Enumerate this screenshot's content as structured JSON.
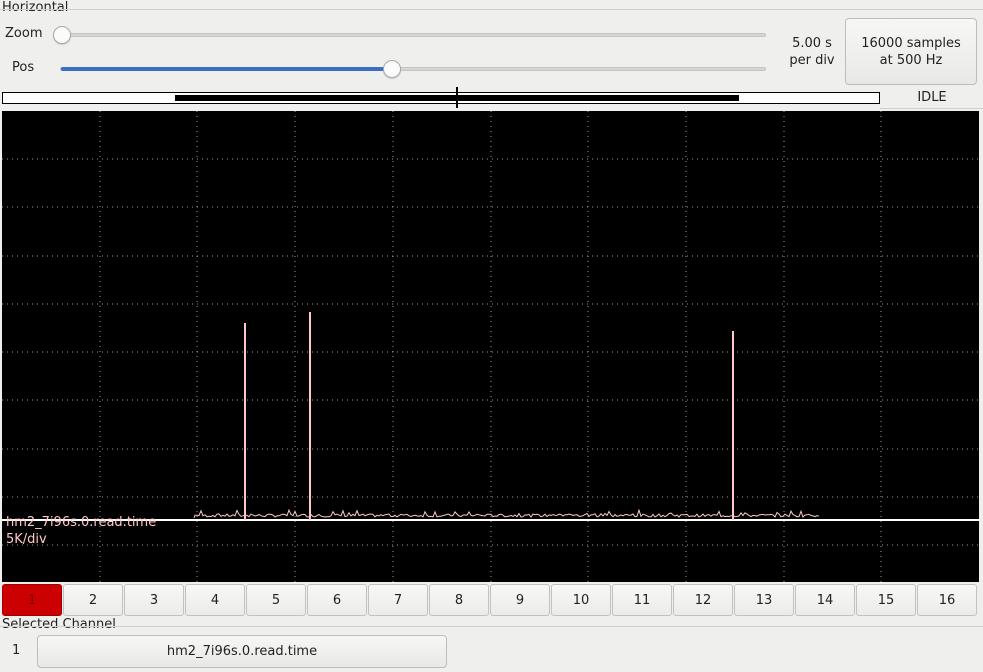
{
  "horizontal": {
    "section_label": "Horizontal",
    "zoom_label": "Zoom",
    "pos_label": "Pos",
    "zoom_fraction": 0.0,
    "pos_fraction": 0.47,
    "timebase_text": "5.00 s\nper div",
    "samples_button": "16000 samples\nat 500 Hz"
  },
  "status": {
    "state": "IDLE"
  },
  "scope": {
    "background": "#000000",
    "grid_color": "#9a9a9a",
    "trace_color": "#ffc8c8",
    "channel_name": "hm2_7i96s.0.read.time",
    "scale": "5K/div"
  },
  "channels": {
    "active": 1,
    "active_color": "#cc0000",
    "labels": [
      "1",
      "2",
      "3",
      "4",
      "5",
      "6",
      "7",
      "8",
      "9",
      "10",
      "11",
      "12",
      "13",
      "14",
      "15",
      "16"
    ]
  },
  "selected": {
    "section_label": "Selected Channel",
    "number": "1",
    "name": "hm2_7i96s.0.read.time"
  }
}
